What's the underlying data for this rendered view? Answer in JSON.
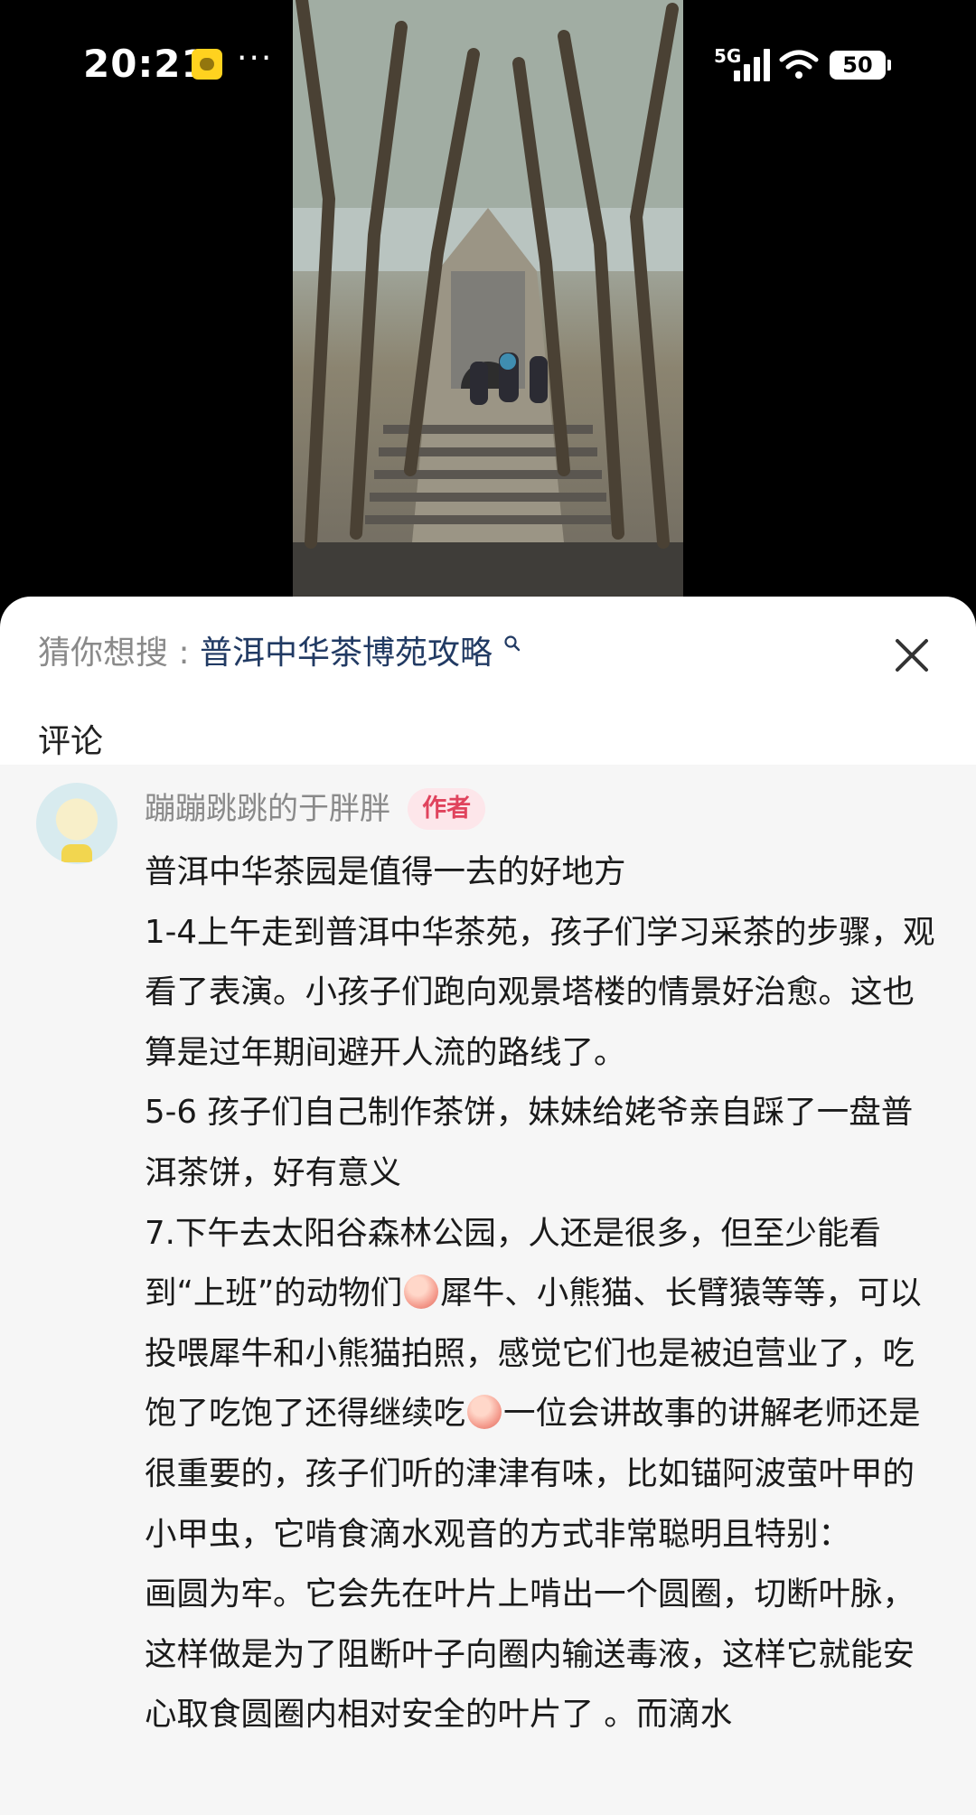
{
  "status_bar": {
    "time": "20:21",
    "more": "···",
    "network": "5G",
    "battery": "50"
  },
  "search_suggestion": {
    "label": "猜你想搜 :",
    "query": "普洱中华茶博苑攻略",
    "icons": [
      "search-icon",
      "close-icon"
    ]
  },
  "comments": {
    "section_title": "评论",
    "items": [
      {
        "author": "蹦蹦跳跳的于胖胖",
        "tag": "作者",
        "paragraphs": [
          {
            "text": "普洱中华茶园是值得一去的好地方"
          },
          {
            "text": "1-4上午走到普洱中华茶苑，孩子们学习采茶的步骤，观看了表演。小孩子们跑向观景塔楼的情景好治愈。这也算是过年期间避开人流的路线了。"
          },
          {
            "text": "5-6 孩子们自己制作茶饼，妹妹给姥爷亲自踩了一盘普洱茶饼，好有意义"
          },
          {
            "seg1": "7.下午去太阳谷森林公园，人还是很多，但至少能看到“上班”的动物们",
            "seg2": "犀牛、小熊猫、长臂猿等等，可以投喂犀牛和小熊猫拍照，感觉它们也是被迫营业了，吃饱了吃饱了还得继续吃",
            "seg3": "一位会讲故事的讲解老师还是很重要的，孩子们听的津津有味，比如锚阿波萤叶甲的小甲虫，它啃食滴水观音的方式非常聪明且特别："
          },
          {
            "text": "画圆为牢。它会先在叶片上啃出一个圆圈，切断叶脉，这样做是为了阻断叶子向圈内输送毒液，这样它就能安心取食圆圈内相对安全的叶片了 。而滴水"
          }
        ]
      }
    ]
  },
  "theme": {
    "tag_bg": "#fde6ea",
    "tag_text": "#e0435d",
    "link_color": "#213a63",
    "comment_bg": "#f6f6f6"
  }
}
